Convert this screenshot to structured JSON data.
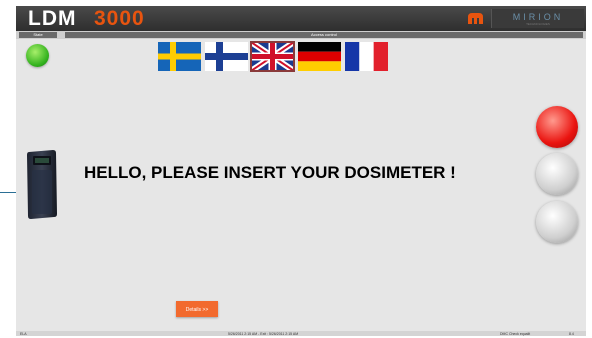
{
  "header": {
    "logo_text": "LDM",
    "logo_number": "3000",
    "brand_name": "MIRION",
    "brand_tagline": "TECHNOLOGIES",
    "accent_color": "#e8540f"
  },
  "statusbar": {
    "state_label": "State",
    "access_label": "Access control"
  },
  "status_indicator": {
    "color": "green"
  },
  "languages": [
    {
      "code": "sv",
      "name": "Swedish"
    },
    {
      "code": "fi",
      "name": "Finnish"
    },
    {
      "code": "en",
      "name": "English",
      "selected": true
    },
    {
      "code": "de",
      "name": "German"
    },
    {
      "code": "fr",
      "name": "French"
    }
  ],
  "main": {
    "message": "HELLO, PLEASE INSERT YOUR DOSIMETER !"
  },
  "lamps": [
    {
      "state": "red"
    },
    {
      "state": "off"
    },
    {
      "state": "off"
    }
  ],
  "details_button": {
    "label": "Details >>"
  },
  "footer": {
    "left": "ELA",
    "center": "5/26/2011 2:15 AM - Exit : 5/26/2011 2:15 AM",
    "right": "DMC Check equalit",
    "version": "8.4"
  }
}
